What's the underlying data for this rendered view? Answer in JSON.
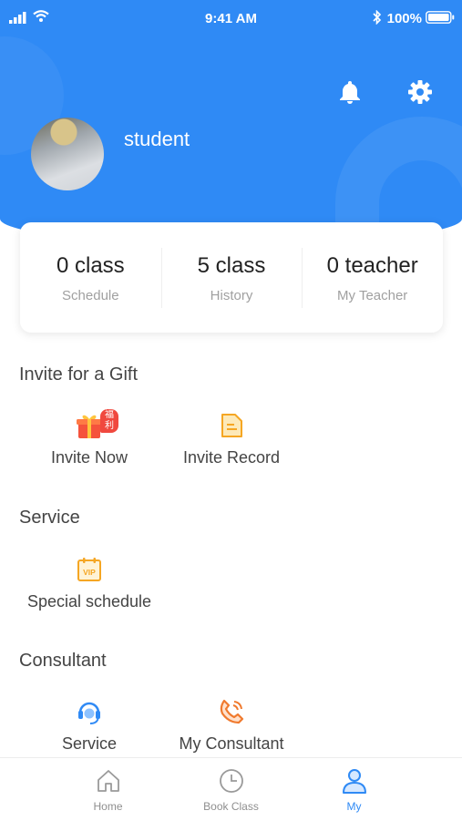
{
  "status_bar": {
    "time": "9:41 AM",
    "battery": "100%"
  },
  "profile": {
    "username": "student"
  },
  "stats": [
    {
      "value": "0 class",
      "label": "Schedule"
    },
    {
      "value": "5 class",
      "label": "History"
    },
    {
      "value": "0 teacher",
      "label": "My Teacher"
    }
  ],
  "sections": {
    "invite": {
      "title": "Invite for a Gift",
      "items": [
        {
          "label": "Invite Now",
          "icon": "gift-icon",
          "badge": "福利"
        },
        {
          "label": "Invite Record",
          "icon": "document-icon"
        }
      ]
    },
    "service": {
      "title": "Service",
      "items": [
        {
          "label": "Special schedule",
          "icon": "vip-calendar-icon"
        }
      ]
    },
    "consultant": {
      "title": "Consultant",
      "items": [
        {
          "label": "Service",
          "icon": "headset-icon"
        },
        {
          "label": "My Consultant",
          "icon": "phone-icon"
        }
      ]
    }
  },
  "tabbar": [
    {
      "label": "Home",
      "icon": "home-icon"
    },
    {
      "label": "Book Class",
      "icon": "clock-icon"
    },
    {
      "label": "My",
      "icon": "person-icon",
      "active": true
    }
  ],
  "colors": {
    "primary": "#2f8af5",
    "accent_orange": "#f5a623",
    "badge_red": "#f0483e"
  }
}
